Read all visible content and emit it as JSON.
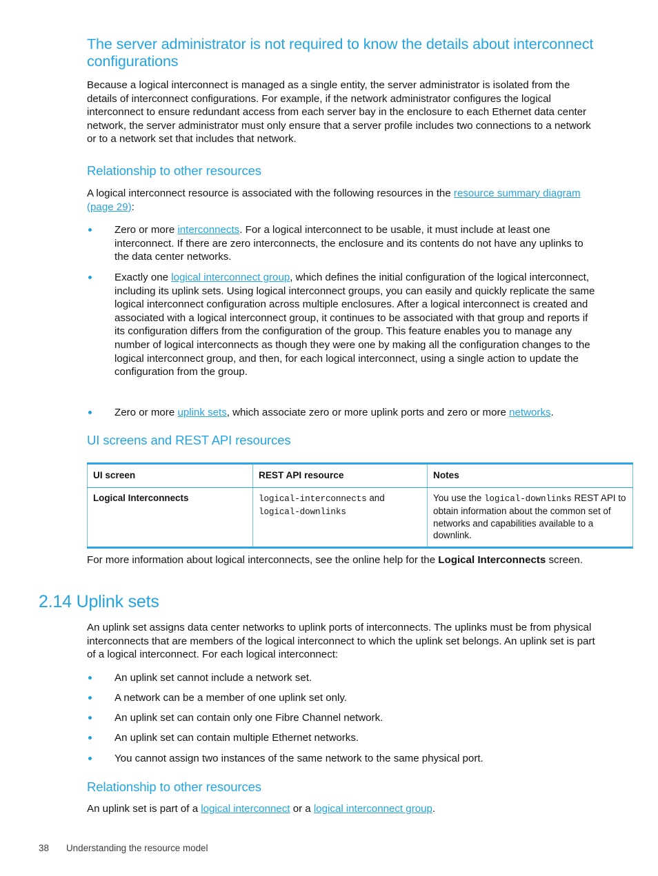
{
  "colors": {
    "accent_blue": "#23a4e0",
    "table_border": "#2ba5e1",
    "body_text": "#131313"
  },
  "headings": {
    "topic": "The server administrator is not required to know the details about interconnect configurations",
    "relationship_1": "Relationship to other resources",
    "ui_screens": "UI screens and REST API resources",
    "section_2_14": "2.14 Uplink sets",
    "relationship_2": "Relationship to other resources"
  },
  "paragraphs": {
    "intro": "Because a logical interconnect is managed as a single entity, the server administrator is isolated from the details of interconnect configurations. For example, if the network administrator configures the logical interconnect to ensure redundant access from each server bay in the enclosure to each Ethernet data center network, the server administrator must only ensure that a server profile includes two connections to a network or to a network set that includes that network.",
    "assoc_lead_a": "A logical interconnect resource is associated with the following resources in the ",
    "assoc_lead_link": "resource summary diagram (page 29)",
    "assoc_lead_b": ":",
    "more_info_a": "For more information about logical interconnects, see the online help for the ",
    "more_info_bold": "Logical Interconnects",
    "more_info_b": " screen.",
    "uplink_intro": "An uplink set assigns data center networks to uplink ports of interconnects. The uplinks must be from physical interconnects that are members of the logical interconnect to which the uplink set belongs. An uplink set is part of a logical interconnect. For each logical interconnect:",
    "uplink_relationship_a": "An uplink set is part of a ",
    "uplink_relationship_link1": "logical interconnect",
    "uplink_relationship_mid": " or a ",
    "uplink_relationship_link2": "logical interconnect group",
    "uplink_relationship_b": "."
  },
  "bullets_resources": [
    {
      "pre": "Zero or more ",
      "link": "interconnects",
      "post": ". For a logical interconnect to be usable, it must include at least one interconnect. If there are zero interconnects, the enclosure and its contents do not have any uplinks to the data center networks."
    },
    {
      "pre": "Exactly one ",
      "link": "logical interconnect group",
      "post": ", which defines the initial configuration of the logical interconnect, including its uplink sets. Using logical interconnect groups, you can easily and quickly replicate the same logical interconnect configuration across multiple enclosures. After a logical interconnect is created and associated with a logical interconnect group, it continues to be associated with that group and reports if its configuration differs from the configuration of the group. This feature enables you to manage any number of logical interconnects as though they were one by making all the configuration changes to the logical interconnect group, and then, for each logical interconnect, using a single action to update the configuration from the group."
    },
    {
      "pre": "Zero or more ",
      "link": "uplink sets",
      "post": ", which associate zero or more uplink ports and zero or more ",
      "link2": "networks",
      "post2": "."
    }
  ],
  "bullets_uplink": [
    "An uplink set cannot include a network set.",
    "A network can be a member of one uplink set only.",
    "An uplink set can contain only one Fibre Channel network.",
    "An uplink set can contain multiple Ethernet networks.",
    "You cannot assign two instances of the same network to the same physical port."
  ],
  "table": {
    "headers": [
      "UI screen",
      "REST API resource",
      "Notes"
    ],
    "rows": [
      {
        "ui_screen": "Logical Interconnects",
        "rest_api_mono_1": "logical-interconnects",
        "rest_api_join": " and ",
        "rest_api_mono_2": "logical-downlinks",
        "notes_pre": "You use the ",
        "notes_mono": "logical-downlinks",
        "notes_post": " REST API to obtain information about the common set of networks and capabilities available to a downlink."
      }
    ]
  },
  "footer": {
    "page_number": "38",
    "chapter_title": "Understanding the resource model"
  }
}
